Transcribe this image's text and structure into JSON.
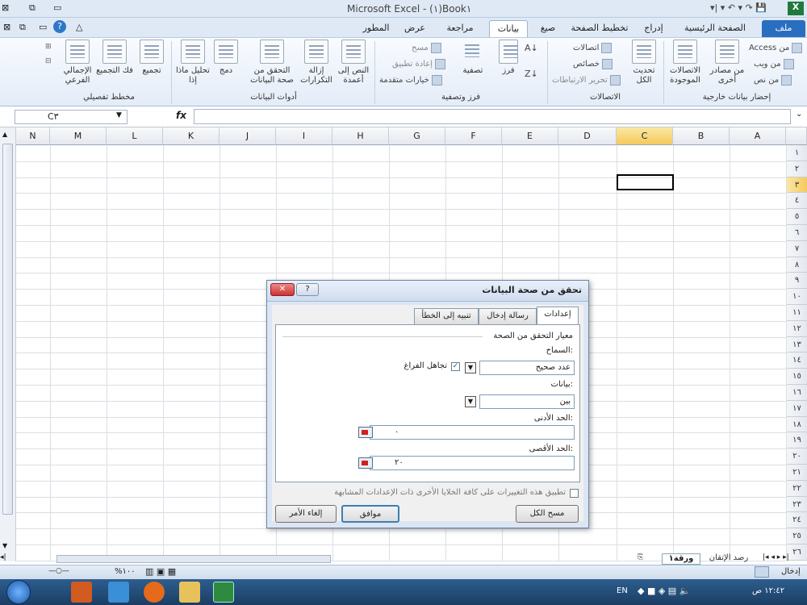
{
  "window": {
    "title": "Microsoft Excel - (١)Book١"
  },
  "tabs": [
    "ملف",
    "الصفحة الرئيسية",
    "إدراج",
    "تخطيط الصفحة",
    "صيغ",
    "بيانات",
    "مراجعة",
    "عرض",
    "المطور"
  ],
  "active_tab": "بيانات",
  "ribbon": {
    "external": {
      "label": "إحضار بيانات خارجية",
      "from_access": "من Access",
      "from_web": "من ويب",
      "from_text": "من نص",
      "other_sources": "من مصادر أخرى",
      "existing": "الاتصالات الموجودة"
    },
    "connections": {
      "label": "الاتصالات",
      "refresh_all": "تحديث الكل",
      "connections": "اتصالات",
      "properties": "خصائص",
      "edit_links": "تحرير الارتباطات"
    },
    "sort_filter": {
      "label": "فرز وتصفية",
      "sort": "فرز",
      "filter": "تصفية",
      "clear": "مسح",
      "reapply": "إعادة تطبيق",
      "advanced": "خيارات متقدمة"
    },
    "data_tools": {
      "label": "أدوات البيانات",
      "text_to_columns": "النص إلى أعمدة",
      "remove_duplicates": "إزالة التكرارات",
      "validation": "التحقق من صحة البيانات",
      "consolidate": "دمج",
      "whatif": "تحليل ماذا إذا"
    },
    "outline": {
      "label": "مخطط تفصيلي",
      "group": "تجميع",
      "ungroup": "فك التجميع",
      "subtotal": "الإجمالي الفرعي"
    }
  },
  "formula_bar": {
    "name_box": "C٣",
    "fx": "fx"
  },
  "columns": [
    "N",
    "M",
    "L",
    "K",
    "J",
    "I",
    "H",
    "G",
    "F",
    "E",
    "D",
    "C",
    "B",
    "A"
  ],
  "rows": [
    "١",
    "٢",
    "٣",
    "٤",
    "٥",
    "٦",
    "٧",
    "٨",
    "٩",
    "١٠",
    "١١",
    "١٢",
    "١٣",
    "١٤",
    "١٥",
    "١٦",
    "١٧",
    "١٨",
    "١٩",
    "٢٠",
    "٢١",
    "٢٢",
    "٢٣",
    "٢٤",
    "٢٥",
    "٢٦"
  ],
  "sheets": {
    "active": "ورقة١",
    "other": "رصد الإتقان"
  },
  "status": {
    "mode": "إدخال",
    "zoom": "%١٠٠"
  },
  "taskbar": {
    "lang": "EN",
    "time": "١٢:٤٢ ص"
  },
  "dialog": {
    "title": "تحقق من صحة البيانات",
    "tabs": [
      "إعدادات",
      "رسالة إدخال",
      "تنبيه إلى الخطأ"
    ],
    "section": "معيار التحقق من الصحة",
    "allow_label": "السماح:",
    "allow_value": "عدد صحيح",
    "ignore_blank": "تجاهل الفراغ",
    "data_label": "بيانات:",
    "data_value": "بين",
    "min_label": "الحد الأدنى:",
    "min_value": "٠",
    "max_label": "الحد الأقصى:",
    "max_value": "٢٠",
    "apply_all": "تطبيق هذه التغييرات على كافة الخلايا الأخرى ذات الإعدادات المشابهة",
    "clear_all": "مسح الكل",
    "ok": "موافق",
    "cancel": "إلغاء الأمر"
  }
}
